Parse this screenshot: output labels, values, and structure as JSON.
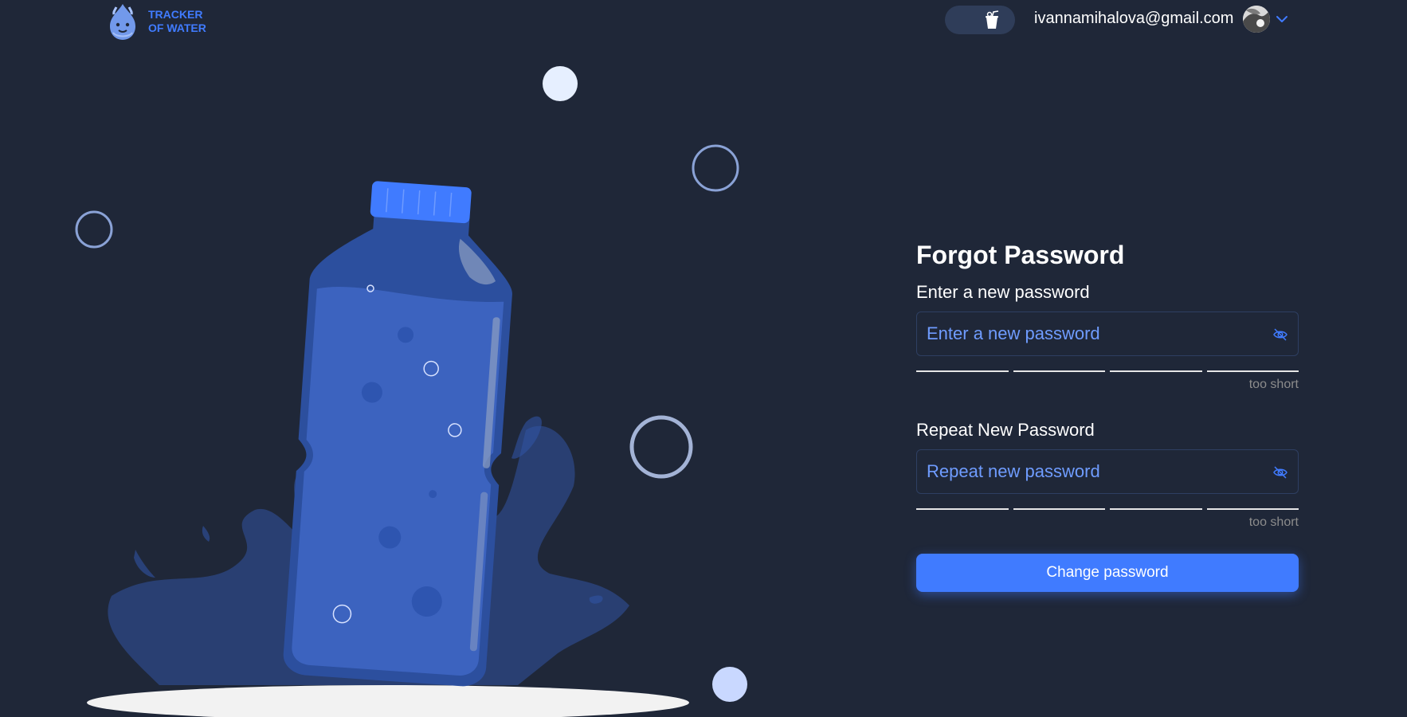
{
  "header": {
    "logo_line1": "TRACKER",
    "logo_line2": "OF WATER",
    "user_email": "ivannamihalova@gmail.com",
    "theme_icon": "cup-icon",
    "menu_icon": "chevron-down-icon"
  },
  "form": {
    "title": "Forgot Password",
    "new_password_label": "Enter a new password",
    "new_password_placeholder": "Enter a new password",
    "new_password_value": "",
    "new_password_strength": "too short",
    "repeat_password_label": "Repeat New Password",
    "repeat_password_placeholder": "Repeat new password",
    "repeat_password_value": "",
    "repeat_password_strength": "too short",
    "submit_label": "Change password"
  },
  "colors": {
    "background": "#1f2738",
    "accent": "#407bff",
    "placeholder": "#6f9cff",
    "muted": "#8c8c8c"
  }
}
